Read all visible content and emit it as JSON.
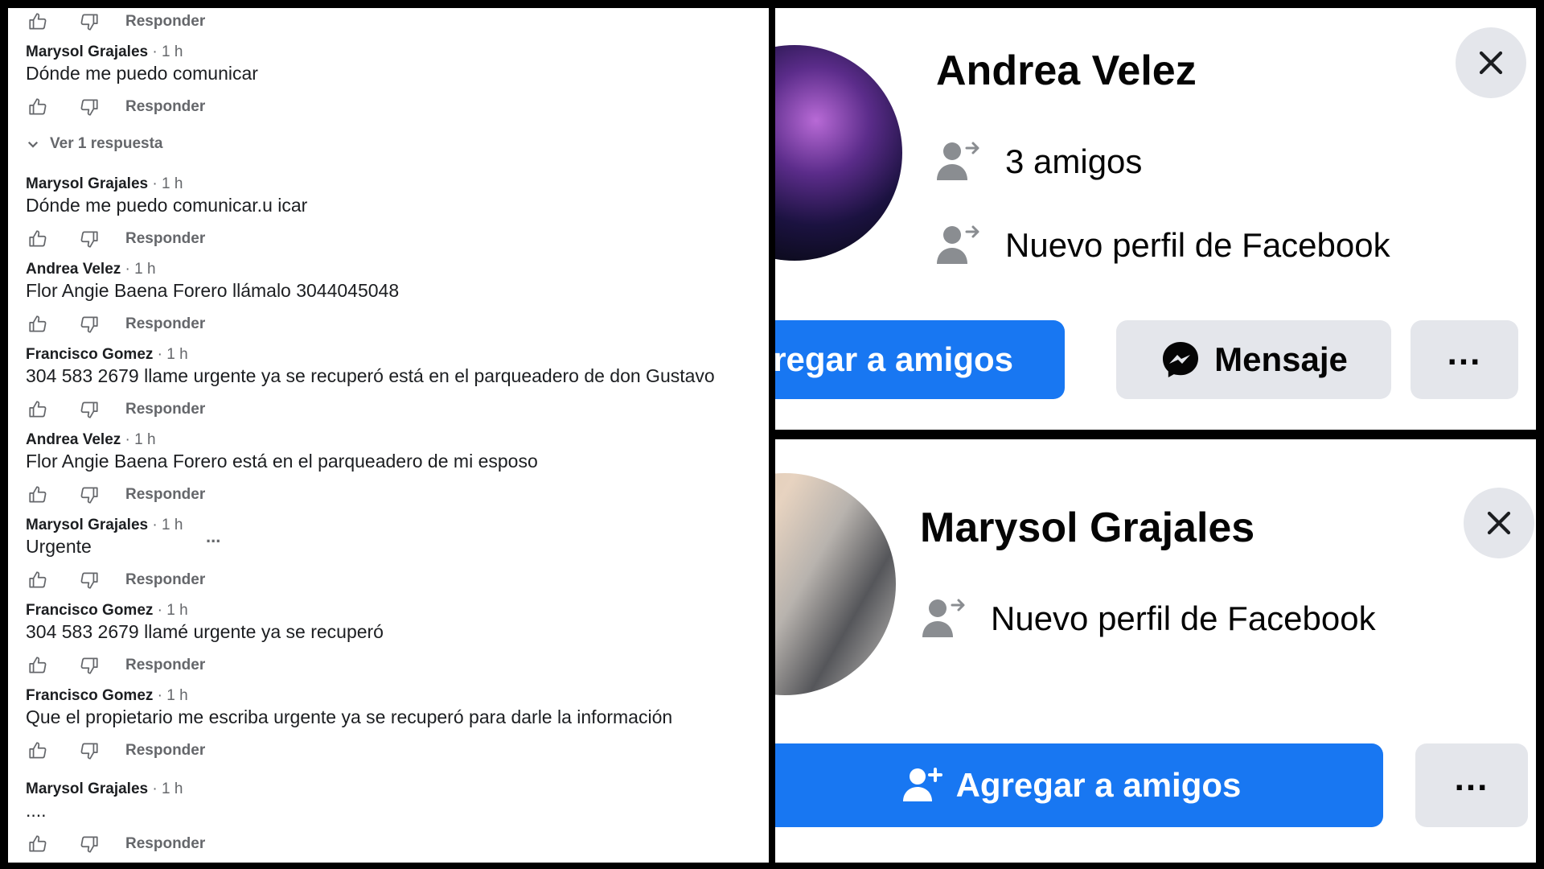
{
  "comments": {
    "reply_label": "Responder",
    "view_replies": "Ver 1 respuesta",
    "items": [
      {
        "author": "Marysol Grajales",
        "time": "1 h",
        "text": "Dónde me puedo comunicar"
      },
      {
        "author": "Marysol Grajales",
        "time": "1 h",
        "text": "Dónde me puedo comunicar.u icar"
      },
      {
        "author": "Andrea Velez",
        "time": "1 h",
        "text": "Flor Angie Baena Forero llámalo 3044045048"
      },
      {
        "author": "Francisco Gomez",
        "time": "1 h",
        "text": "304 583 2679 llame urgente ya se recuperó está en el parqueadero de don Gustavo"
      },
      {
        "author": "Andrea Velez",
        "time": "1 h",
        "text": "Flor Angie Baena Forero está en el parqueadero de mi esposo"
      },
      {
        "author": "Marysol Grajales",
        "time": "1 h",
        "text": "Urgente",
        "more": "..."
      },
      {
        "author": "Francisco Gomez",
        "time": "1 h",
        "text": "304 583 2679 llamé urgente ya se recuperó"
      },
      {
        "author": "Francisco Gomez",
        "time": "1 h",
        "text": "Que el propietario me escriba urgente ya se recuperó para darle la información"
      },
      {
        "author": "Marysol Grajales",
        "time": "1 h",
        "text": "...."
      }
    ]
  },
  "profile_andrea": {
    "name": "Andrea Velez",
    "friends": "3 amigos",
    "status": "Nuevo perfil de Facebook",
    "add_friend": "Agregar a amigos",
    "message": "Mensaje",
    "more": "..."
  },
  "profile_marysol": {
    "name": "Marysol Grajales",
    "status": "Nuevo perfil de Facebook",
    "add_friend": "Agregar a amigos",
    "more": "..."
  },
  "colors": {
    "facebook_blue": "#1877f2",
    "button_gray": "#e4e6eb",
    "secondary_text": "#65676b"
  },
  "icons": [
    "thumbs-up-icon",
    "thumbs-down-icon",
    "chevron-down-icon",
    "person-arrow-icon",
    "close-icon",
    "messenger-icon",
    "add-person-icon"
  ]
}
